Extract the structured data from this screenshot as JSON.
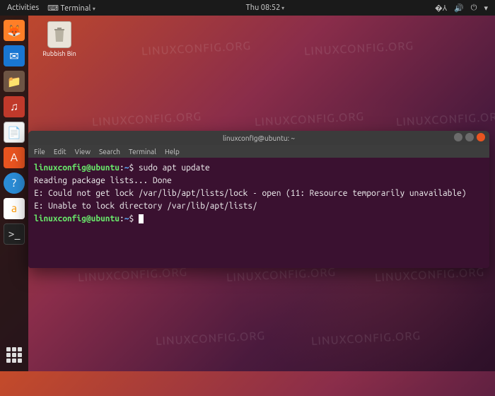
{
  "topbar": {
    "activities": "Activities",
    "app_menu": "Terminal",
    "clock": "Thu 08:52"
  },
  "desktop": {
    "trash_label": "Rubbish Bin"
  },
  "dock": {
    "items": [
      {
        "name": "firefox",
        "glyph": "🦊"
      },
      {
        "name": "thunderbird",
        "glyph": "✉"
      },
      {
        "name": "files",
        "glyph": "📁"
      },
      {
        "name": "rhythmbox",
        "glyph": "♫"
      },
      {
        "name": "document",
        "glyph": "📄"
      },
      {
        "name": "software",
        "glyph": "A"
      },
      {
        "name": "help",
        "glyph": "?"
      },
      {
        "name": "amazon",
        "glyph": "a"
      },
      {
        "name": "terminal",
        "glyph": ">_"
      }
    ]
  },
  "terminal": {
    "title": "linuxconfig@ubuntu: ~",
    "menu": [
      "File",
      "Edit",
      "View",
      "Search",
      "Terminal",
      "Help"
    ],
    "prompt_user_host": "linuxconfig@ubuntu",
    "prompt_path": "~",
    "prompt_symbol": "$",
    "lines": {
      "command": "sudo apt update",
      "out1": "Reading package lists... Done",
      "out2": "E: Could not get lock /var/lib/apt/lists/lock - open (11: Resource temporarily unavailable)",
      "out3": "E: Unable to lock directory /var/lib/apt/lists/"
    }
  },
  "watermark": "LINUXCONFIG.ORG"
}
